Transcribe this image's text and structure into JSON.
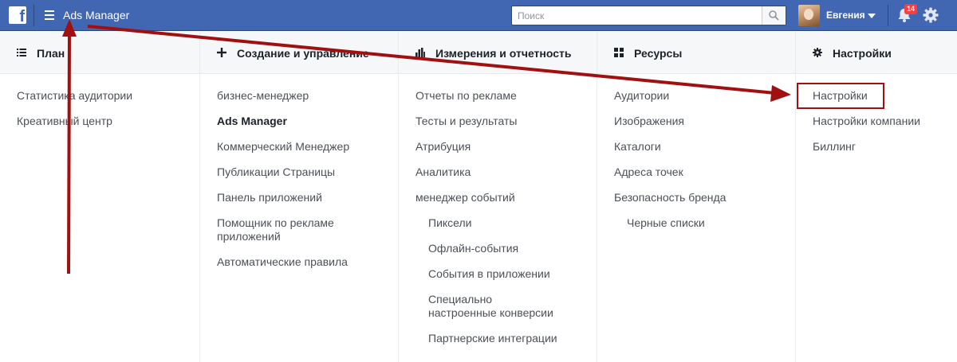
{
  "topbar": {
    "logo_letter": "f",
    "app_title": "Ads Manager",
    "search_placeholder": "Поиск",
    "user_name": "Евгения",
    "notification_count": "14"
  },
  "columns": [
    {
      "icon": "list-icon",
      "title": "План",
      "items": [
        {
          "label": "Статистика аудитории"
        },
        {
          "label": "Креативный центр"
        }
      ]
    },
    {
      "icon": "plus-icon",
      "title": "Создание и управление",
      "items": [
        {
          "label": "бизнес-менеджер"
        },
        {
          "label": "Ads Manager",
          "active": true
        },
        {
          "label": "Коммерческий Менеджер"
        },
        {
          "label": "Публикации Страницы"
        },
        {
          "label": "Панель приложений"
        },
        {
          "label": "Помощник по рекламе приложений"
        },
        {
          "label": "Автоматические правила"
        }
      ]
    },
    {
      "icon": "bar-chart-icon",
      "title": "Измерения и отчетность",
      "items": [
        {
          "label": "Отчеты по рекламе"
        },
        {
          "label": "Тесты и результаты"
        },
        {
          "label": "Атрибуция"
        },
        {
          "label": "Аналитика"
        },
        {
          "label": "менеджер событий"
        },
        {
          "label": "Пиксели",
          "sub": true
        },
        {
          "label": "Офлайн-события",
          "sub": true
        },
        {
          "label": "События в приложении",
          "sub": true
        },
        {
          "label": "Специально настроенные конверсии",
          "sub": true
        },
        {
          "label": "Партнерские интеграции",
          "sub": true
        }
      ]
    },
    {
      "icon": "grid-icon",
      "title": "Ресурсы",
      "items": [
        {
          "label": "Аудитории"
        },
        {
          "label": "Изображения"
        },
        {
          "label": "Каталоги"
        },
        {
          "label": "Адреса точек"
        },
        {
          "label": "Безопасность бренда"
        },
        {
          "label": "Черные списки",
          "sub": true
        }
      ]
    },
    {
      "icon": "gear-icon",
      "title": "Настройки",
      "items": [
        {
          "label": "Настройки",
          "highlighted": true
        },
        {
          "label": "Настройки компании"
        },
        {
          "label": "Биллинг"
        }
      ]
    }
  ],
  "colors": {
    "topbar": "#4267b2",
    "annotation_arrow": "#a01010",
    "badge": "#fa3e3e"
  }
}
